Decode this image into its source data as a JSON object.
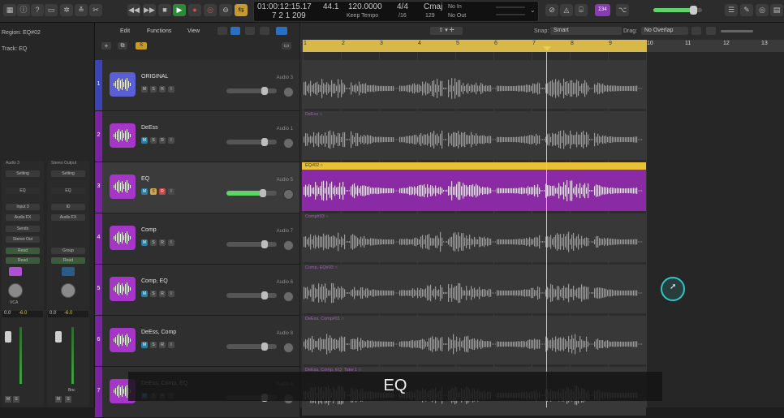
{
  "lcd": {
    "position": "01:00:12:15.17",
    "bars": "7  2  1  209",
    "tempo": "120.0000",
    "sample_rate": "44.1",
    "tempo_mode": "Keep Tempo",
    "time_sig": "4/4",
    "division": "/16",
    "key": "Cmaj",
    "key_value": "129",
    "in": "No In",
    "out": "No Out"
  },
  "controlbar": {
    "badge": "Ʃ34"
  },
  "inspector": {
    "region_label": "Region: EQ#02",
    "track_label": "Track: EQ",
    "strip1": {
      "name": "Audio 3",
      "setting": "Setting",
      "eq": "EQ",
      "input": "Input 3",
      "fx": "Audio FX",
      "sends": "Sends",
      "output": "Stereo Out",
      "read": "Read",
      "group": "VCA",
      "vol": "0.0",
      "pan": "-6.0",
      "m": "M",
      "s": "S"
    },
    "strip2": {
      "name": "Stereo Output",
      "setting": "Setting",
      "eq": "EQ",
      "input": "ID",
      "fx": "Audio FX",
      "group": "Group",
      "read": "Read",
      "vol": "0.0",
      "pan": "-6.0",
      "bnc": "Bnc",
      "m": "M",
      "s": "S"
    }
  },
  "toolbar": {
    "edit": "Edit",
    "functions": "Functions",
    "view": "View",
    "snap_label": "Snap:",
    "snap_value": "Smart",
    "drag_label": "Drag:",
    "drag_value": "No Overlap"
  },
  "ruler": {
    "bars": [
      "1",
      "2",
      "3",
      "4",
      "5",
      "6",
      "7",
      "8",
      "9",
      "10",
      "11",
      "12",
      "13"
    ]
  },
  "tracks": [
    {
      "num": "1",
      "name": "ORIGINAL",
      "out": "Audio 3",
      "color": "#5b5fd6",
      "num_color": "#3b43b8",
      "slider": 0.75,
      "region": "",
      "m": "M",
      "s": "S",
      "r": "R",
      "i": "I"
    },
    {
      "num": "2",
      "name": "DeEss",
      "out": "Audio 1",
      "color": "#a536c8",
      "num_color": "#7a23a2",
      "slider": 0.75,
      "region": "DeEss",
      "m": "M",
      "s": "S",
      "r": "R",
      "i": "I"
    },
    {
      "num": "3",
      "name": "EQ",
      "out": "Audio 5",
      "color": "#a536c8",
      "num_color": "#7a23a2",
      "slider": 0.72,
      "region": "EQ#02",
      "m": "M",
      "s": "S",
      "r": "R",
      "i": "I"
    },
    {
      "num": "4",
      "name": "Comp",
      "out": "Audio 7",
      "color": "#a536c8",
      "num_color": "#7a23a2",
      "slider": 0.75,
      "region": "Comp#03",
      "m": "M",
      "s": "S",
      "r": "R",
      "i": "I"
    },
    {
      "num": "5",
      "name": "Comp, EQ",
      "out": "Audio 6",
      "color": "#a536c8",
      "num_color": "#7a23a2",
      "slider": 0.75,
      "region": "Comp, EQ#03",
      "m": "M",
      "s": "S",
      "r": "R",
      "i": "I"
    },
    {
      "num": "6",
      "name": "DeEss, Comp",
      "out": "Audio 8",
      "color": "#a536c8",
      "num_color": "#7a23a2",
      "slider": 0.75,
      "region": "DeEss, Comp#01",
      "m": "M",
      "s": "S",
      "r": "R",
      "i": "I"
    },
    {
      "num": "7",
      "name": "DeEss, Comp, EQ",
      "out": "Audio 4",
      "color": "#a536c8",
      "num_color": "#7a23a2",
      "slider": 0.75,
      "region": "DeEss, Comp, EQ: Take 1",
      "m": "M",
      "s": "S",
      "r": "R",
      "i": "I"
    }
  ],
  "caption": "EQ",
  "colors": {
    "accent_purple": "#a536c8",
    "region_selected": "#8a2aa5",
    "ruler_cycle": "#d9b84a",
    "playhead": "#e6d34c",
    "green_slider": "#5ed46a"
  }
}
